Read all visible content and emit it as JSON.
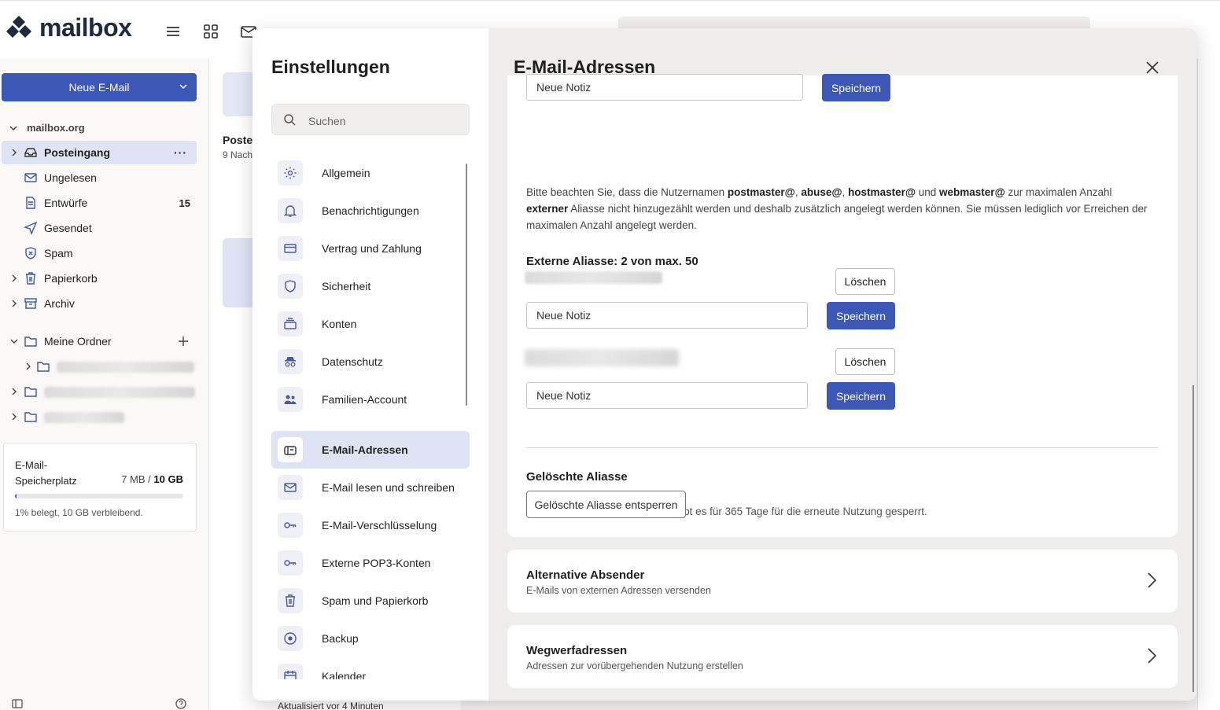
{
  "app": {
    "logo_text": "mailbox",
    "accent": "#3c57b5"
  },
  "sidebar": {
    "new_mail_label": "Neue E-Mail",
    "account": "mailbox.org",
    "folders": [
      {
        "label": "Posteingang",
        "icon": "inbox-icon",
        "more": "···"
      },
      {
        "label": "Ungelesen",
        "icon": "envelope-icon"
      },
      {
        "label": "Entwürfe",
        "icon": "document-icon",
        "count": "15"
      },
      {
        "label": "Gesendet",
        "icon": "send-icon"
      },
      {
        "label": "Spam",
        "icon": "spam-shield-icon"
      },
      {
        "label": "Papierkorb",
        "icon": "trash-icon"
      },
      {
        "label": "Archiv",
        "icon": "archive-icon"
      }
    ],
    "my_folders_label": "Meine Ordner",
    "storage": {
      "title": "E-Mail-Speicherplatz",
      "used": "7 MB",
      "sep": "/",
      "total": "10 GB",
      "percent": 1,
      "note": "1% belegt, 10 GB verbleibend."
    }
  },
  "midlist": {
    "title": "Poste",
    "subtitle": "9 Nach",
    "footer": "Aktualisiert vor 4 Minuten"
  },
  "settings": {
    "title": "Einstellungen",
    "search_placeholder": "Suchen",
    "nav": [
      {
        "label": "Allgemein",
        "icon": "gear-icon"
      },
      {
        "label": "Benachrichtigungen",
        "icon": "bell-icon"
      },
      {
        "label": "Vertrag und Zahlung",
        "icon": "credit-card-icon"
      },
      {
        "label": "Sicherheit",
        "icon": "shield-icon"
      },
      {
        "label": "Konten",
        "icon": "accounts-stack-icon"
      },
      {
        "label": "Datenschutz",
        "icon": "incognito-icon"
      },
      {
        "label": "Familien-Account",
        "icon": "family-icon"
      },
      {
        "label": "E-Mail-Adressen",
        "icon": "mailbox-icon",
        "active": true
      },
      {
        "label": "E-Mail lesen und schreiben",
        "icon": "envelope-icon"
      },
      {
        "label": "E-Mail-Verschlüsselung",
        "icon": "key-icon"
      },
      {
        "label": "Externe POP3-Konten",
        "icon": "key-icon"
      },
      {
        "label": "Spam und Papierkorb",
        "icon": "trash-icon"
      },
      {
        "label": "Backup",
        "icon": "backup-disc-icon"
      },
      {
        "label": "Kalender",
        "icon": "calendar-icon"
      }
    ]
  },
  "content": {
    "title": "E-Mail-Adressen",
    "note_placeholder": "Neue Notiz",
    "save_label": "Speichern",
    "delete_label": "Löschen",
    "info": {
      "p1": "Bitte beachten Sie, dass die Nutzernamen ",
      "u1": "postmaster@",
      "s1": ", ",
      "u2": "abuse@",
      "s2": ", ",
      "u3": "hostmaster@",
      "s3": " und ",
      "u4": "webmaster@",
      "p2": " zur maximalen Anzahl ",
      "u5": "externer",
      "p3": " Aliasse nicht hinzugezählt werden und deshalb zusätzlich angelegt werden können. Sie müssen lediglich vor Erreichen der maximalen Anzahl angelegt werden."
    },
    "external_aliases_heading": "Externe Aliasse: 2 von max. 50",
    "deleted_heading": "Gelöschte Aliasse",
    "deleted_text": "Wenn ein Alias gelöscht wird, bleibt es für 365 Tage für die erneute Nutzung gesperrt.",
    "unlock_label": "Gelöschte Aliasse entsperren",
    "sections": [
      {
        "title": "Alternative Absender",
        "subtitle": "E-Mails von externen Adressen versenden"
      },
      {
        "title": "Wegwerfadressen",
        "subtitle": "Adressen zur vorübergehenden Nutzung erstellen"
      }
    ]
  }
}
